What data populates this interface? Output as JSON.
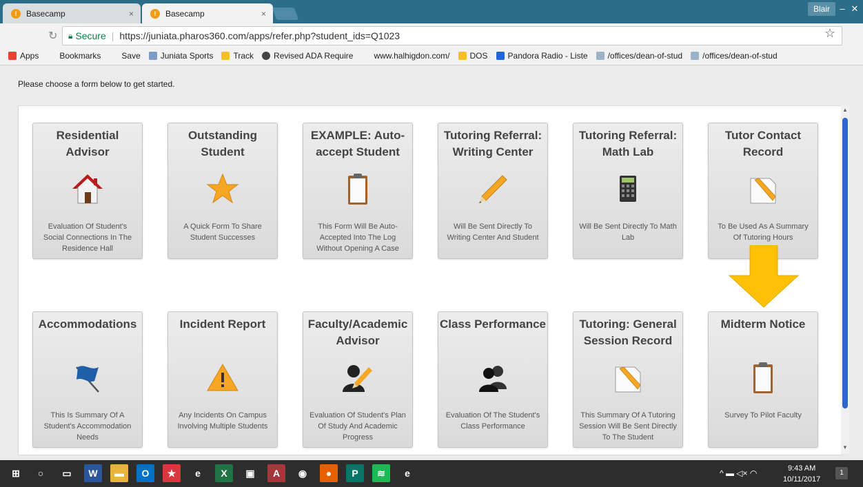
{
  "browser": {
    "tabs": [
      {
        "label": "Basecamp",
        "close": "×"
      },
      {
        "label": "Basecamp",
        "close": "×"
      }
    ],
    "profile": "Blair",
    "window_controls": [
      "–",
      "▢",
      "✕"
    ],
    "secure_label": "Secure",
    "url": "https://juniata.pharos360.com/apps/refer.php?student_ids=Q1023",
    "bookmarks": [
      {
        "label": "Apps",
        "color": "#e94235"
      },
      {
        "label": "Bookmarks",
        "color": "#f2f2f2"
      },
      {
        "label": "Save",
        "color": "#f2f2f2"
      },
      {
        "label": "Juniata Sports",
        "color": "#7a9cc6"
      },
      {
        "label": "Track",
        "color": "#f6c026"
      },
      {
        "label": "Revised ADA Require",
        "color": "#444444"
      },
      {
        "label": "www.halhigdon.com/",
        "color": "#f2f2f2"
      },
      {
        "label": "DOS",
        "color": "#f6c026"
      },
      {
        "label": "Pandora Radio - Liste",
        "color": "#2266dd"
      },
      {
        "label": "/offices/dean-of-stud",
        "color": "#9ab3c9"
      },
      {
        "label": "/offices/dean-of-stud",
        "color": "#9ab3c9"
      }
    ]
  },
  "page": {
    "intro": "Please choose a form below to get started.",
    "cards": [
      {
        "title": "Residential Advisor",
        "desc": "Evaluation Of Student's Social Connections In The Residence Hall",
        "icon": "house-icon"
      },
      {
        "title": "Outstanding Student",
        "desc": "A Quick Form To Share Student Successes",
        "icon": "star-icon"
      },
      {
        "title": "EXAMPLE: Auto-accept Student",
        "desc": "This Form Will Be Auto-Accepted Into The Log Without Opening A Case",
        "icon": "clipboard-icon"
      },
      {
        "title": "Tutoring Referral: Writing Center",
        "desc": "Will Be Sent Directly To Writing Center And Student",
        "icon": "pencil-icon"
      },
      {
        "title": "Tutoring Referral: Math Lab",
        "desc": "Will Be Sent Directly To Math Lab",
        "icon": "calculator-icon"
      },
      {
        "title": "Tutor Contact Record",
        "desc": "To Be Used As A Summary Of Tutoring Hours",
        "icon": "note-pencil-icon"
      },
      {
        "title": "Accommodations",
        "desc": "This Is Summary Of A Student's Accommodation Needs",
        "icon": "flag-icon"
      },
      {
        "title": "Incident Report",
        "desc": "Any Incidents On Campus Involving Multiple Students",
        "icon": "warning-icon"
      },
      {
        "title": "Faculty/Academic Advisor",
        "desc": "Evaluation Of Student's Plan Of Study And Academic Progress",
        "icon": "advisor-icon"
      },
      {
        "title": "Class Performance",
        "desc": "Evaluation Of The Student's Class Performance",
        "icon": "group-icon"
      },
      {
        "title": "Tutoring: General Session Record",
        "desc": "This Summary Of A Tutoring Session Will Be Sent Directly To The Student",
        "icon": "note-pencil-icon"
      },
      {
        "title": "Midterm Notice",
        "desc": "Survey To Pilot Faculty",
        "icon": "clipboard-icon"
      }
    ],
    "arrow_color": "#ffc107"
  },
  "taskbar": {
    "time": "9:43 AM",
    "date": "10/11/2017",
    "notifications": "1",
    "apps": [
      {
        "name": "start-icon",
        "glyph": "⊞",
        "color": "#2d2d2d"
      },
      {
        "name": "search-icon",
        "glyph": "○",
        "color": "#2d2d2d"
      },
      {
        "name": "task-view-icon",
        "glyph": "▭",
        "color": "#2d2d2d"
      },
      {
        "name": "word-icon",
        "glyph": "W",
        "color": "#2b579a"
      },
      {
        "name": "file-explorer-icon",
        "glyph": "▬",
        "color": "#e8b53a"
      },
      {
        "name": "outlook-icon",
        "glyph": "O",
        "color": "#0072c6"
      },
      {
        "name": "app-red-icon",
        "glyph": "★",
        "color": "#d9363e"
      },
      {
        "name": "edge-icon",
        "glyph": "e",
        "color": "#2d2d2d"
      },
      {
        "name": "excel-icon",
        "glyph": "X",
        "color": "#217346"
      },
      {
        "name": "store-icon",
        "glyph": "▣",
        "color": "#2d2d2d"
      },
      {
        "name": "access-icon",
        "glyph": "A",
        "color": "#a4373a"
      },
      {
        "name": "chrome-icon",
        "glyph": "◉",
        "color": "#2d2d2d"
      },
      {
        "name": "firefox-icon",
        "glyph": "●",
        "color": "#e66000"
      },
      {
        "name": "publisher-icon",
        "glyph": "P",
        "color": "#077568"
      },
      {
        "name": "spotify-icon",
        "glyph": "≋",
        "color": "#1db954"
      },
      {
        "name": "ie-icon",
        "glyph": "e",
        "color": "#2d2d2d"
      }
    ]
  }
}
